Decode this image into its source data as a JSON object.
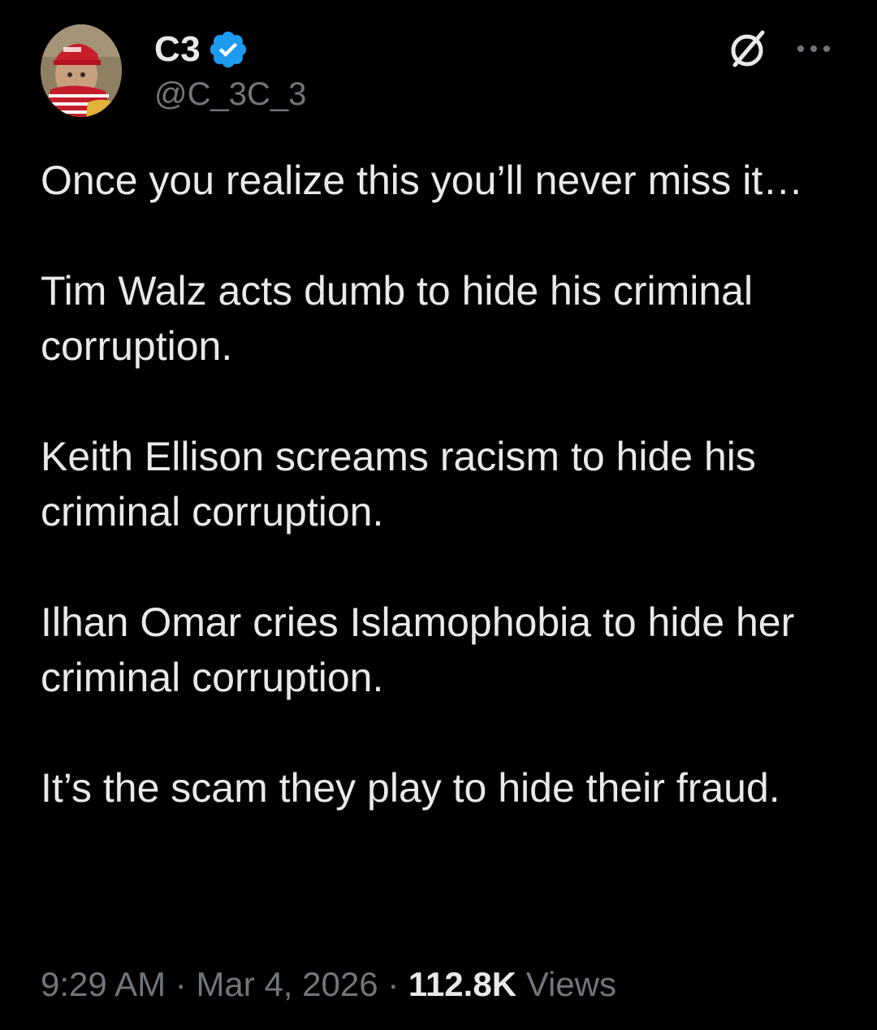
{
  "author": {
    "display_name": "C3",
    "handle": "@C_3C_3",
    "verified": true,
    "verified_color": "#1d9bf0"
  },
  "header_icons": {
    "grok": "grok-icon",
    "more": "more-icon"
  },
  "tweet": {
    "paragraphs": [
      "Once you realize this you’ll never miss it…",
      "Tim Walz acts dumb to hide his criminal corruption.",
      "Keith Ellison screams racism to hide his criminal corruption.",
      "Ilhan Omar cries Islamophobia to hide her criminal corruption.",
      "It’s the scam they play to hide their fraud."
    ]
  },
  "meta": {
    "time": "9:29 AM",
    "separator": " · ",
    "date": "Mar 4, 2026",
    "views_count": "112.8K",
    "views_label": " Views"
  },
  "colors": {
    "background": "#000000",
    "text_primary": "#e7e9ea",
    "text_secondary": "#71767b"
  }
}
